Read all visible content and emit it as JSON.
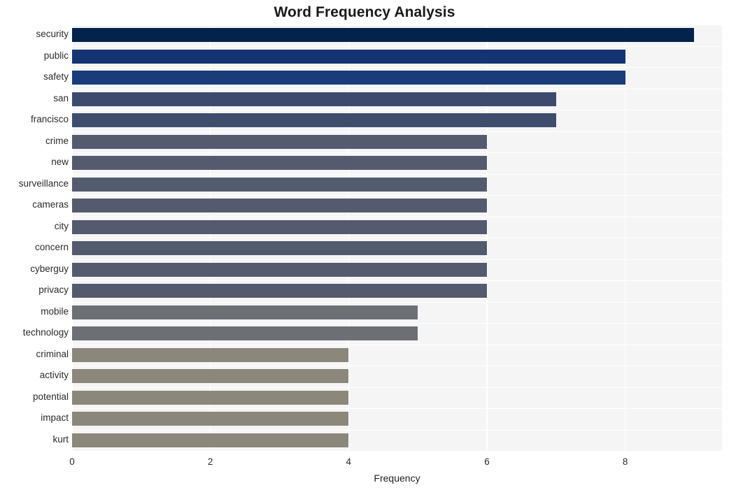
{
  "chart_data": {
    "type": "bar",
    "orientation": "horizontal",
    "title": "Word Frequency Analysis",
    "xlabel": "Frequency",
    "ylabel": "",
    "categories": [
      "security",
      "public",
      "safety",
      "san",
      "francisco",
      "crime",
      "new",
      "surveillance",
      "cameras",
      "city",
      "concern",
      "cyberguy",
      "privacy",
      "mobile",
      "technology",
      "criminal",
      "activity",
      "potential",
      "impact",
      "kurt"
    ],
    "values": [
      9,
      8,
      8,
      7,
      7,
      6,
      6,
      6,
      6,
      6,
      6,
      6,
      6,
      5,
      5,
      4,
      4,
      4,
      4,
      4
    ],
    "bar_colors": [
      "#03224c",
      "#153472",
      "#1a3c78",
      "#3c4a6d",
      "#3e4c6e",
      "#555b6e",
      "#555b6e",
      "#555b6e",
      "#555b6e",
      "#555b6e",
      "#555b6e",
      "#555b6e",
      "#555b6e",
      "#6c6f74",
      "#6c6f74",
      "#8b877a",
      "#8b877a",
      "#8b877a",
      "#8b877a",
      "#8b877a"
    ],
    "xticks": [
      0,
      2,
      4,
      6,
      8
    ],
    "xlim": [
      0,
      9.4
    ],
    "grid": true,
    "grid_color": "#ffffff",
    "plot_background": "#f5f5f6",
    "figure_background": "#ffffff"
  }
}
